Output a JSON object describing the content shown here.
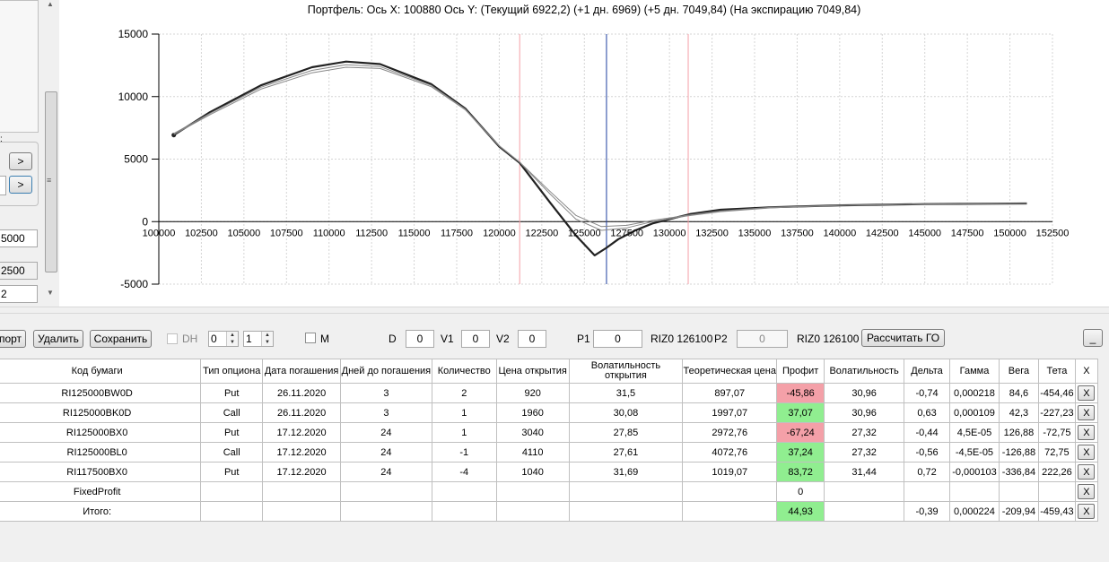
{
  "colors": {
    "profit_negative": "#f4a0a8",
    "profit_positive": "#90ee90",
    "curve": "#222222",
    "curve_thin": "#888888",
    "vline_red": "#f4a0a8",
    "vline_blue": "#1f3fa0"
  },
  "left_panel": {
    "arrow1": ">",
    "arrow2": ">",
    "field1": "5000",
    "field2": "2500",
    "field3": "2"
  },
  "chart": {
    "title": "Портфель: Ось X: 100880 Ось Y:  (Текущий 6922,2)  (+1 дн. 6969)  (+5 дн. 7049,84)  (На экспирацию 7049,84)"
  },
  "chart_data": {
    "type": "line",
    "xlim": [
      100000,
      152500
    ],
    "ylim": [
      -5000,
      15000
    ],
    "grid": true,
    "x_ticks": [
      "100000",
      "102500",
      "105000",
      "107500",
      "110000",
      "112500",
      "115000",
      "117500",
      "120000",
      "122500",
      "125000",
      "127500",
      "130000",
      "132500",
      "135000",
      "137500",
      "140000",
      "142500",
      "145000",
      "147500",
      "150000",
      "152500"
    ],
    "y_ticks": [
      "15000",
      "10000",
      "5000",
      "0",
      "-5000"
    ],
    "vlines": [
      {
        "x": 121200,
        "color": "red"
      },
      {
        "x": 126300,
        "color": "blue"
      },
      {
        "x": 131100,
        "color": "red"
      }
    ],
    "series": [
      {
        "style": "thick",
        "x": [
          100880,
          103000,
          106000,
          109000,
          111000,
          113000,
          116000,
          118000,
          120000,
          121200,
          123000,
          124500,
          125600,
          126300,
          127000,
          128000,
          129000,
          130000,
          131200,
          133000,
          136000,
          140000,
          145000,
          151000
        ],
        "y": [
          6922,
          8750,
          10900,
          12350,
          12800,
          12600,
          11000,
          9050,
          6000,
          4700,
          1500,
          -1100,
          -2700,
          -2100,
          -1400,
          -700,
          -150,
          200,
          600,
          950,
          1150,
          1300,
          1400,
          1450
        ]
      },
      {
        "style": "thin",
        "x": [
          100880,
          103000,
          106000,
          109000,
          111000,
          113000,
          116000,
          118000,
          120000,
          121200,
          123000,
          124500,
          126000,
          127500,
          129000,
          131000,
          133000,
          136000,
          140000,
          145000,
          151000
        ],
        "y": [
          6969,
          8550,
          10600,
          11900,
          12350,
          12250,
          10800,
          8950,
          6050,
          4750,
          2400,
          500,
          -400,
          -300,
          100,
          500,
          850,
          1150,
          1300,
          1400,
          1450
        ]
      },
      {
        "style": "thin",
        "x": [
          100880,
          103000,
          106000,
          109000,
          111000,
          113000,
          116000,
          118000,
          120000,
          121200,
          123000,
          124500,
          126000,
          127500,
          129000,
          131000,
          133000,
          136000,
          140000,
          145000,
          151000
        ],
        "y": [
          7050,
          8650,
          10750,
          12100,
          12550,
          12400,
          10900,
          9000,
          6050,
          4750,
          2200,
          200,
          -700,
          -500,
          0,
          450,
          800,
          1100,
          1300,
          1400,
          1450
        ]
      }
    ]
  },
  "toolbar": {
    "export": "порт",
    "delete": "Удалить",
    "save": "Сохранить",
    "dh": "DH",
    "spin1": "0",
    "spin2": "1",
    "m": "M",
    "d_label": "D",
    "d_val": "0",
    "v1_label": "V1",
    "v1_val": "0",
    "v2_label": "V2",
    "v2_val": "0",
    "p1_label": "P1",
    "p1_val": "0",
    "riz1": "RIZ0 126100",
    "p2_label": "P2",
    "p2_val": "0",
    "riz2": "RIZ0 126100",
    "calc": "Рассчитать ГО",
    "min": "_"
  },
  "table": {
    "headers": [
      "Код бумаги",
      "Тип опциона",
      "Дата погашения",
      "Дней до погашения",
      "Количество",
      "Цена открытия",
      "Волатильность открытия",
      "Теоретическая цена",
      "Профит",
      "Волатильность",
      "Дельта",
      "Гамма",
      "Вега",
      "Тета",
      "X"
    ],
    "rows": [
      {
        "cells": [
          "RI125000BW0D",
          "Put",
          "26.11.2020",
          "3",
          "2",
          "920",
          "31,5",
          "897,07",
          "-45,86",
          "30,96",
          "-0,74",
          "0,000218",
          "84,6",
          "-454,46"
        ],
        "profit": "neg",
        "x": "X"
      },
      {
        "cells": [
          "RI125000BK0D",
          "Call",
          "26.11.2020",
          "3",
          "1",
          "1960",
          "30,08",
          "1997,07",
          "37,07",
          "30,96",
          "0,63",
          "0,000109",
          "42,3",
          "-227,23"
        ],
        "profit": "pos",
        "x": "X"
      },
      {
        "cells": [
          "RI125000BX0",
          "Put",
          "17.12.2020",
          "24",
          "1",
          "3040",
          "27,85",
          "2972,76",
          "-67,24",
          "27,32",
          "-0,44",
          "4,5E-05",
          "126,88",
          "-72,75"
        ],
        "profit": "neg",
        "x": "X"
      },
      {
        "cells": [
          "RI125000BL0",
          "Call",
          "17.12.2020",
          "24",
          "-1",
          "4110",
          "27,61",
          "4072,76",
          "37,24",
          "27,32",
          "-0,56",
          "-4,5E-05",
          "-126,88",
          "72,75"
        ],
        "profit": "pos",
        "x": "X"
      },
      {
        "cells": [
          "RI117500BX0",
          "Put",
          "17.12.2020",
          "24",
          "-4",
          "1040",
          "31,69",
          "1019,07",
          "83,72",
          "31,44",
          "0,72",
          "-0,000103",
          "-336,84",
          "222,26"
        ],
        "profit": "pos",
        "x": "X"
      },
      {
        "cells": [
          "FixedProfit",
          "",
          "",
          "",
          "",
          "",
          "",
          "",
          "0",
          "",
          "",
          "",
          "",
          ""
        ],
        "profit": "none",
        "x": "X"
      },
      {
        "cells": [
          "Итого:",
          "",
          "",
          "",
          "",
          "",
          "",
          "",
          "44,93",
          "",
          "-0,39",
          "0,000224",
          "-209,94",
          "-459,43"
        ],
        "profit": "pos",
        "x": "X"
      }
    ]
  }
}
